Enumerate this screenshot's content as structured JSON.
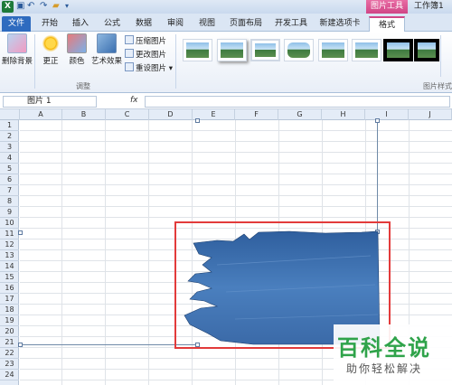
{
  "quick_access": {
    "logo": "X",
    "undo_icon": "undo-icon",
    "redo_icon": "redo-icon",
    "open_icon": "folder-icon"
  },
  "context_tab": "图片工具",
  "window_title": "工作簿1",
  "tabs": [
    "文件",
    "开始",
    "插入",
    "公式",
    "数据",
    "审阅",
    "视图",
    "页面布局",
    "开发工具",
    "新建选项卡",
    "格式"
  ],
  "ribbon": {
    "remove_bg": "删除背景",
    "corrections": "更正",
    "color": "颜色",
    "artistic": "艺术效果",
    "compress": "压缩图片",
    "change": "更改图片",
    "reset": "重设图片",
    "group_adjust": "调整",
    "group_styles": "图片样式"
  },
  "formula_bar": {
    "name_box": "图片 1",
    "fx": "fx",
    "value": ""
  },
  "columns": [
    "A",
    "B",
    "C",
    "D",
    "E",
    "F",
    "G",
    "H",
    "I",
    "J"
  ],
  "rows": [
    "1",
    "2",
    "3",
    "4",
    "5",
    "6",
    "7",
    "8",
    "9",
    "10",
    "11",
    "12",
    "13",
    "14",
    "15",
    "16",
    "17",
    "18",
    "19",
    "20",
    "21",
    "22",
    "23",
    "24"
  ],
  "watermark": {
    "title": "百科全说",
    "subtitle": "助你轻松解决"
  },
  "colors": {
    "accent": "#d04586",
    "file_tab": "#2e6bbf",
    "highlight": "#e23b3b",
    "water": "#3d6fae"
  }
}
